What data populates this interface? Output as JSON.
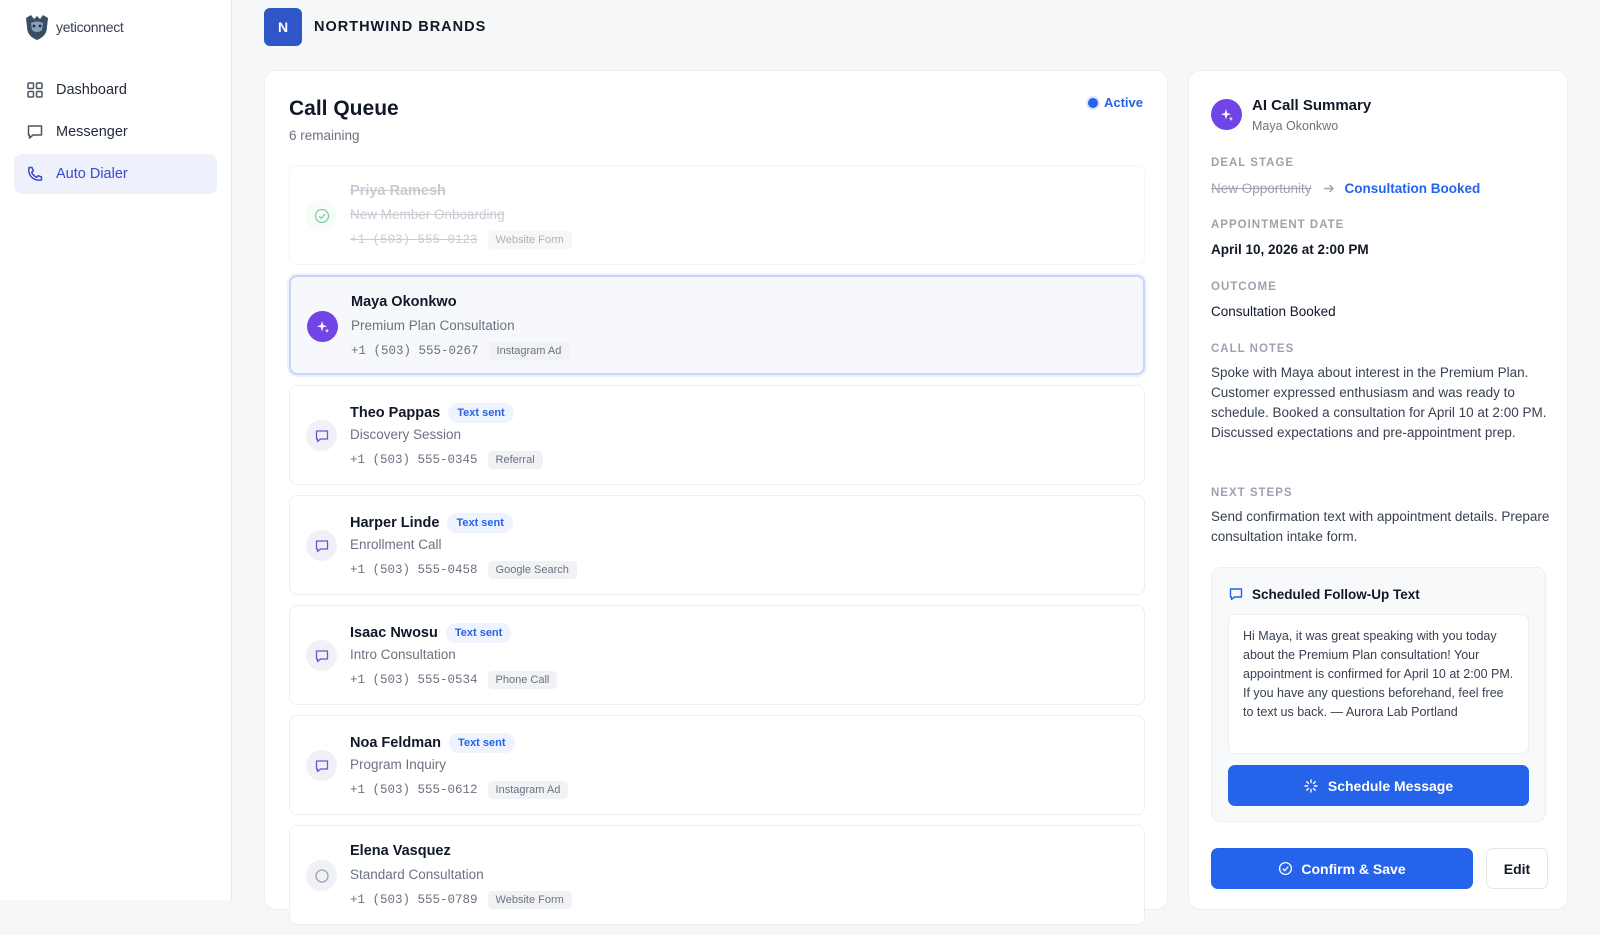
{
  "app": {
    "logo_text": "yeticonnect"
  },
  "sidebar": {
    "items": [
      {
        "label": "Dashboard",
        "icon": "grid-icon"
      },
      {
        "label": "Messenger",
        "icon": "message-icon"
      },
      {
        "label": "Auto Dialer",
        "icon": "phone-icon",
        "active": true
      }
    ]
  },
  "org": {
    "initial": "N",
    "name": "NORTHWIND BRANDS"
  },
  "queue": {
    "title": "Call Queue",
    "remaining": "6 remaining",
    "status": "Active",
    "calls": [
      {
        "name": "Priya Ramesh",
        "type": "New Member Onboarding",
        "phone": "+1 (503) 555-0123",
        "source": "Website Form",
        "state": "done"
      },
      {
        "name": "Maya Okonkwo",
        "type": "Premium Plan Consultation",
        "phone": "+1 (503) 555-0267",
        "source": "Instagram Ad",
        "state": "current"
      },
      {
        "name": "Theo Pappas",
        "type": "Discovery Session",
        "phone": "+1 (503) 555-0345",
        "source": "Referral",
        "badge": "Text sent",
        "state": "texted"
      },
      {
        "name": "Harper Linde",
        "type": "Enrollment Call",
        "phone": "+1 (503) 555-0458",
        "source": "Google Search",
        "badge": "Text sent",
        "state": "texted"
      },
      {
        "name": "Isaac Nwosu",
        "type": "Intro Consultation",
        "phone": "+1 (503) 555-0534",
        "source": "Phone Call",
        "badge": "Text sent",
        "state": "texted"
      },
      {
        "name": "Noa Feldman",
        "type": "Program Inquiry",
        "phone": "+1 (503) 555-0612",
        "source": "Instagram Ad",
        "badge": "Text sent",
        "state": "texted"
      },
      {
        "name": "Elena Vasquez",
        "type": "Standard Consultation",
        "phone": "+1 (503) 555-0789",
        "source": "Website Form",
        "state": "pending"
      }
    ]
  },
  "summary": {
    "title": "AI Call Summary",
    "contact": "Maya Okonkwo",
    "deal_stage_label": "DEAL STAGE",
    "deal_stage_from": "New Opportunity",
    "deal_stage_to": "Consultation Booked",
    "appointment_label": "APPOINTMENT DATE",
    "appointment": "April 10, 2026 at 2:00 PM",
    "outcome_label": "OUTCOME",
    "outcome": "Consultation Booked",
    "notes_label": "CALL NOTES",
    "notes": "Spoke with Maya about interest in the Premium Plan. Customer expressed enthusiasm and was ready to schedule. Booked a consultation for April 10 at 2:00 PM. Discussed expectations and pre-appointment prep.",
    "next_label": "NEXT STEPS",
    "next": "Send confirmation text with appointment details. Prepare consultation intake form.",
    "followup": {
      "title": "Scheduled Follow-Up Text",
      "message": "Hi Maya, it was great speaking with you today about the Premium Plan consultation! Your appointment is confirmed for April 10 at 2:00 PM. If you have any questions beforehand, feel free to text us back. — Aurora Lab Portland",
      "button": "Schedule Message"
    },
    "confirm_button": "Confirm & Save",
    "edit_button": "Edit"
  },
  "colors": {
    "accent": "#2563eb",
    "ai_purple": "#7044e7",
    "active_nav": "#3949c9"
  }
}
